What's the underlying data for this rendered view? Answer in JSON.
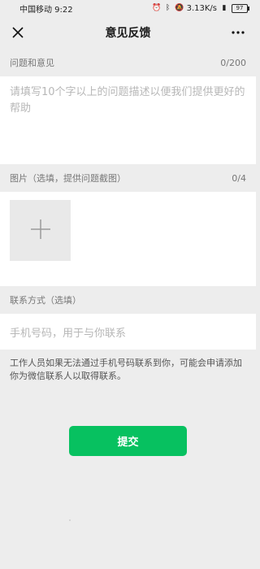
{
  "status_bar": {
    "carrier_time": "中国移动 9:22",
    "speed": "3.13K/s",
    "battery": "97",
    "icons": [
      "alarm-icon",
      "bluetooth-icon",
      "mute-icon",
      "signal-icon"
    ]
  },
  "nav": {
    "title": "意见反馈",
    "close_icon": "close-icon",
    "more_icon": "more-icon"
  },
  "feedback": {
    "label": "问题和意见",
    "counter": "0/200",
    "placeholder": "请填写10个字以上的问题描述以便我们提供更好的帮助"
  },
  "images": {
    "label": "图片（选填，提供问题截图）",
    "counter": "0/4",
    "add_icon": "plus-icon"
  },
  "contact": {
    "label": "联系方式（选填）",
    "placeholder": "手机号码，用于与你联系"
  },
  "note": "工作人员如果无法通过手机号码联系到你，可能会申请添加你为微信联系人以取得联系。",
  "submit_label": "提交",
  "colors": {
    "accent": "#07c160",
    "background": "#ededed"
  }
}
